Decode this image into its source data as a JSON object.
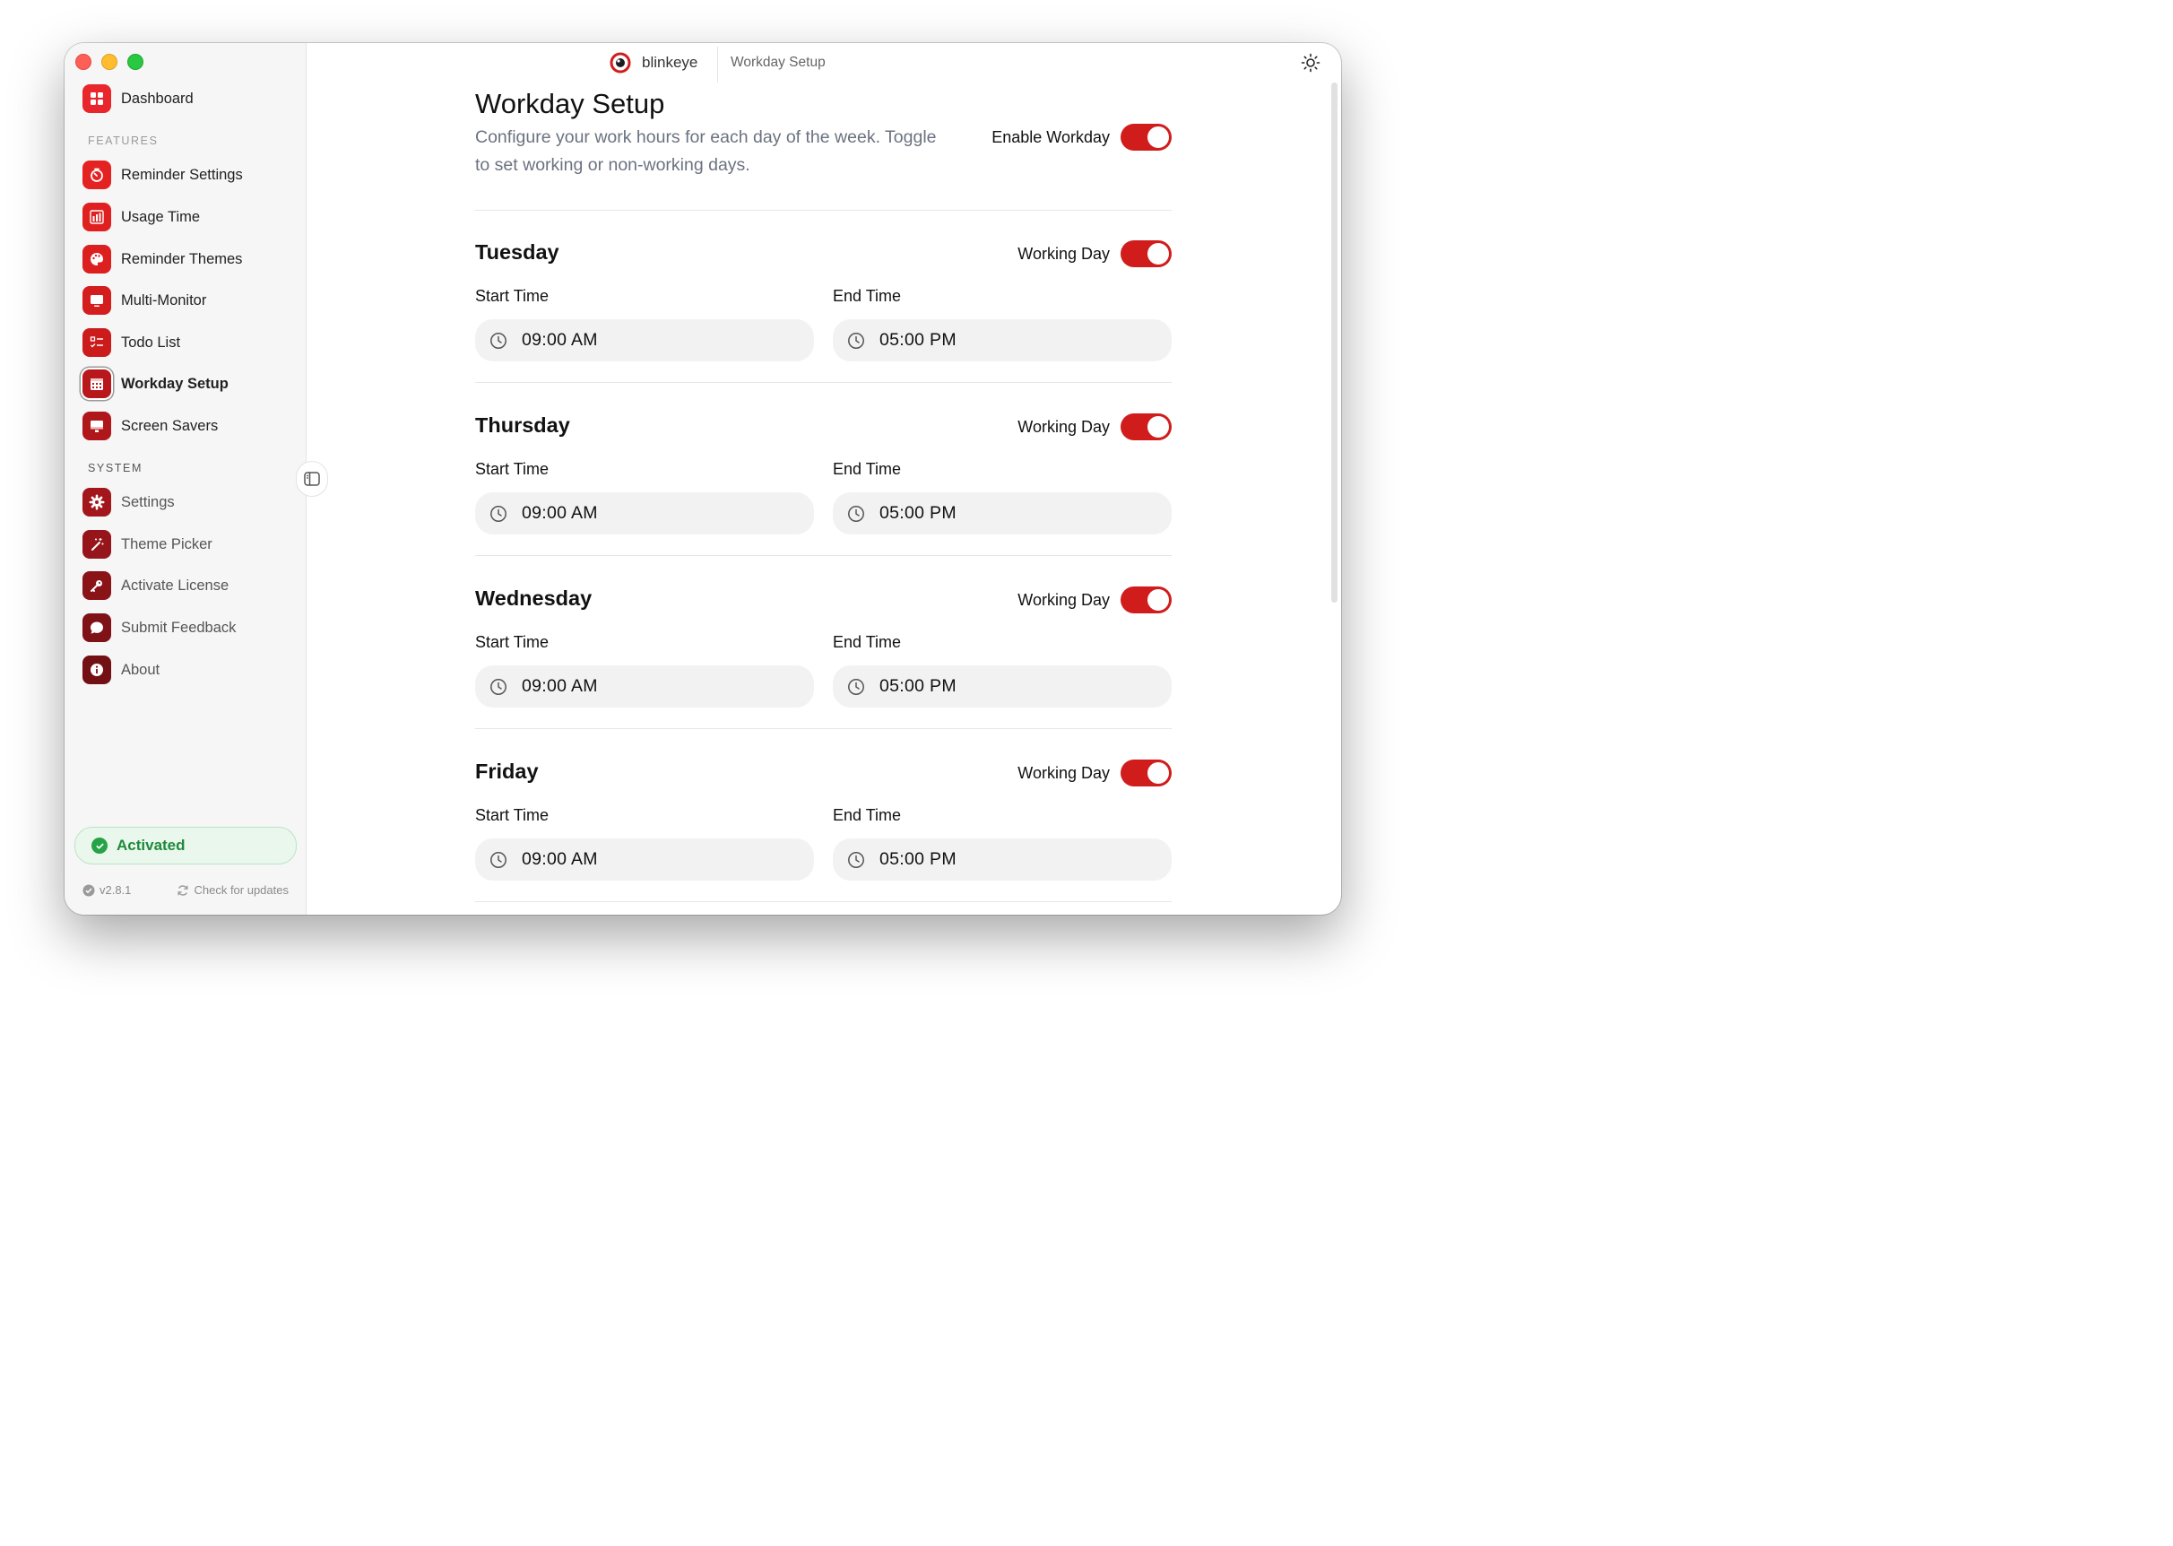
{
  "app": {
    "name": "blinkeye",
    "breadcrumb": "Workday Setup"
  },
  "sidebar": {
    "top_items": [
      {
        "label": "Dashboard",
        "icon": "dashboard-grid-icon"
      }
    ],
    "features_label": "FEATURES",
    "features": [
      {
        "label": "Reminder Settings",
        "icon": "timer-icon"
      },
      {
        "label": "Usage Time",
        "icon": "bar-chart-icon"
      },
      {
        "label": "Reminder Themes",
        "icon": "palette-icon"
      },
      {
        "label": "Multi-Monitor",
        "icon": "monitor-icon"
      },
      {
        "label": "Todo List",
        "icon": "checklist-icon"
      },
      {
        "label": "Workday Setup",
        "icon": "calendar-icon",
        "active": true
      },
      {
        "label": "Screen Savers",
        "icon": "screen-icon"
      }
    ],
    "system_label": "SYSTEM",
    "system": [
      {
        "label": "Settings",
        "icon": "gear-icon"
      },
      {
        "label": "Theme Picker",
        "icon": "magic-wand-icon"
      },
      {
        "label": "Activate License",
        "icon": "key-icon"
      },
      {
        "label": "Submit Feedback",
        "icon": "chat-bubble-icon"
      },
      {
        "label": "About",
        "icon": "info-icon"
      }
    ],
    "license_status": "Activated",
    "version": "v2.8.1",
    "check_updates": "Check for updates"
  },
  "page": {
    "title": "Workday Setup",
    "subtitle": "Configure your work hours for each day of the week. Toggle to set working or non-working days.",
    "enable_label": "Enable Workday",
    "enable_on": true,
    "start_label": "Start Time",
    "end_label": "End Time",
    "working_label": "Working Day",
    "days": [
      {
        "name": "Tuesday",
        "working": true,
        "start": "09:00 AM",
        "end": "05:00 PM"
      },
      {
        "name": "Thursday",
        "working": true,
        "start": "09:00 AM",
        "end": "05:00 PM"
      },
      {
        "name": "Wednesday",
        "working": true,
        "start": "09:00 AM",
        "end": "05:00 PM"
      },
      {
        "name": "Friday",
        "working": true,
        "start": "09:00 AM",
        "end": "05:00 PM"
      }
    ]
  },
  "colors": {
    "accent": "#d11c1c",
    "dashboard_icon": "#e8262b",
    "features_icon": "#d61f1f",
    "system_icon_1": "#a3161c",
    "system_icon_2": "#8e1418",
    "system_icon_3": "#7a1216",
    "activated_green": "#26a347"
  }
}
